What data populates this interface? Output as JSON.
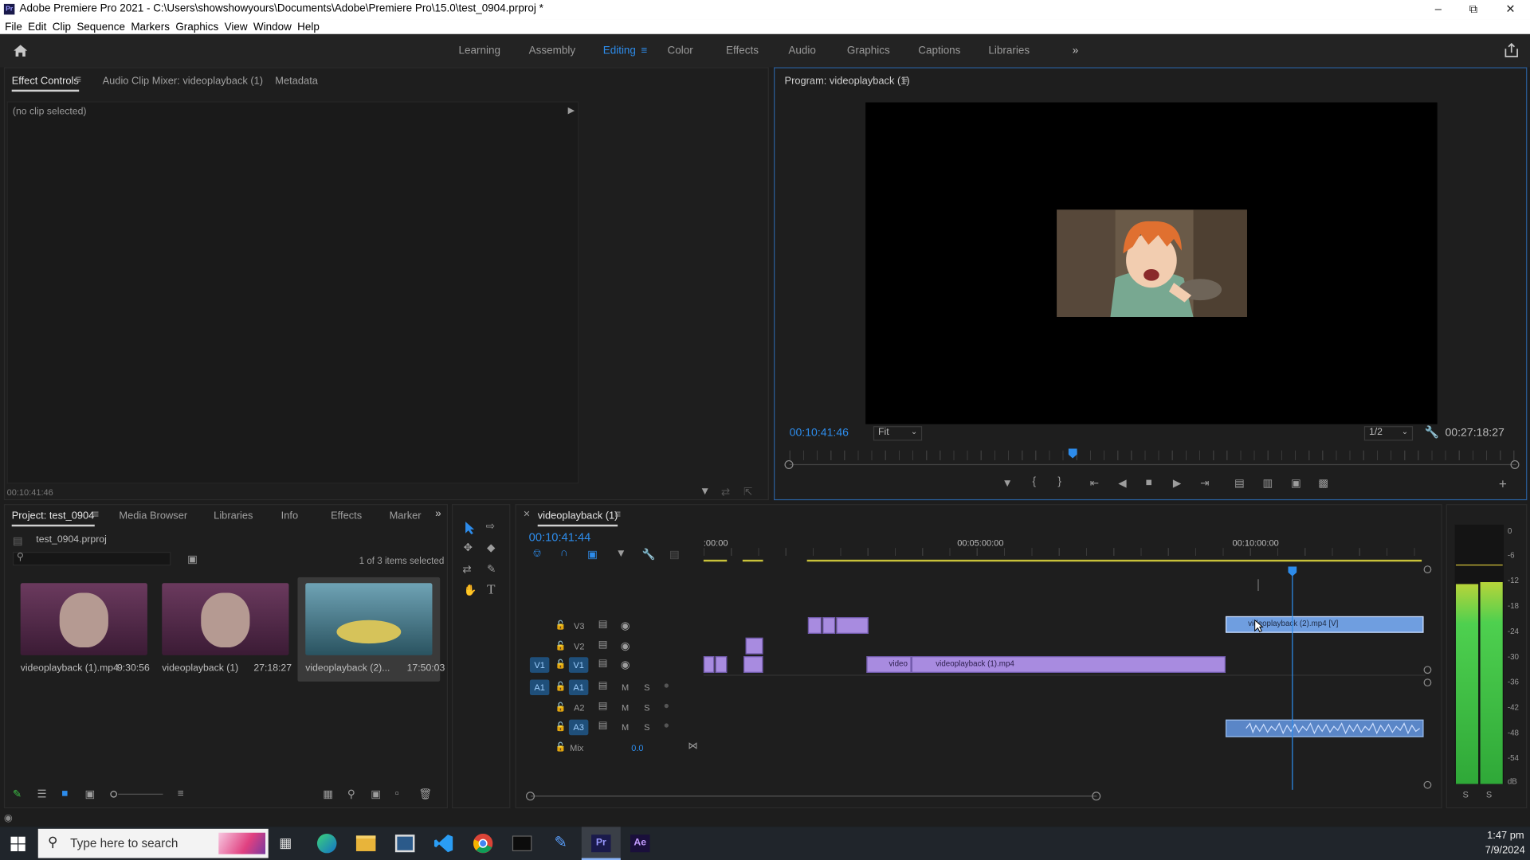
{
  "titlebar": {
    "title": "Adobe Premiere Pro 2021 - C:\\Users\\showshowyours\\Documents\\Adobe\\Premiere Pro\\15.0\\test_0904.prproj *"
  },
  "menu": [
    "File",
    "Edit",
    "Clip",
    "Sequence",
    "Markers",
    "Graphics",
    "View",
    "Window",
    "Help"
  ],
  "workspaces": [
    "Learning",
    "Assembly",
    "Editing",
    "Color",
    "Effects",
    "Audio",
    "Graphics",
    "Captions",
    "Libraries"
  ],
  "active_workspace": "Editing",
  "source_panel": {
    "tabs": [
      "Effect Controls",
      "Audio Clip Mixer: videoplayback (1)",
      "Metadata"
    ],
    "no_clip": "(no clip selected)",
    "timecode": "00:10:41:46"
  },
  "program_monitor": {
    "title": "Program: videoplayback (1)",
    "timecode": "00:10:41:46",
    "fit": "Fit",
    "resolution": "1/2",
    "duration": "00:27:18:27",
    "playhead_fraction": 0.389
  },
  "project_panel": {
    "tabs": [
      "Project: test_0904",
      "Media Browser",
      "Libraries",
      "Info",
      "Effects",
      "Marker"
    ],
    "project_file": "test_0904.prproj",
    "selection_status": "1 of 3 items selected",
    "items": [
      {
        "name": "videoplayback (1).mp4",
        "duration": "9:30:56"
      },
      {
        "name": "videoplayback (1)",
        "duration": "27:18:27"
      },
      {
        "name": "videoplayback (2)...",
        "duration": "17:50:03"
      }
    ]
  },
  "timeline": {
    "sequence_tab": "videoplayback (1)",
    "timecode": "00:10:41:44",
    "ruler": [
      ":00:00",
      "00:05:00:00",
      "00:10:00:00"
    ],
    "video_tracks": [
      "V3",
      "V2",
      "V1"
    ],
    "audio_tracks": [
      "A1",
      "A2",
      "A3"
    ],
    "source_patch_v": "V1",
    "source_patch_a": "A1",
    "mix_label": "Mix",
    "mix_value": "0.0",
    "track_toggles": {
      "mute": "M",
      "solo": "S"
    },
    "clips": {
      "v3_clip": "videoplayback (2).mp4 [V]",
      "v1_clip_a": "video",
      "v1_clip_b": "videoplayback (1).mp4"
    }
  },
  "audio_meter": {
    "scale": [
      "0",
      "-6",
      "-12",
      "-18",
      "-24",
      "-30",
      "-36",
      "-42",
      "-48",
      "-54",
      "dB"
    ],
    "solo_labels": [
      "S",
      "S"
    ],
    "left_level": 0.77,
    "right_level": 0.78
  },
  "taskbar": {
    "search_placeholder": "Type here to search",
    "time": "1:47 pm",
    "date": "7/9/2024",
    "app_labels": {
      "premiere": "Pr",
      "after_effects": "Ae"
    }
  },
  "colors": {
    "accent": "#2d8ceb",
    "video_clip": "#a88be0",
    "selected_clip": "#6f9ee0",
    "audio_meter": "#3dbd45"
  }
}
